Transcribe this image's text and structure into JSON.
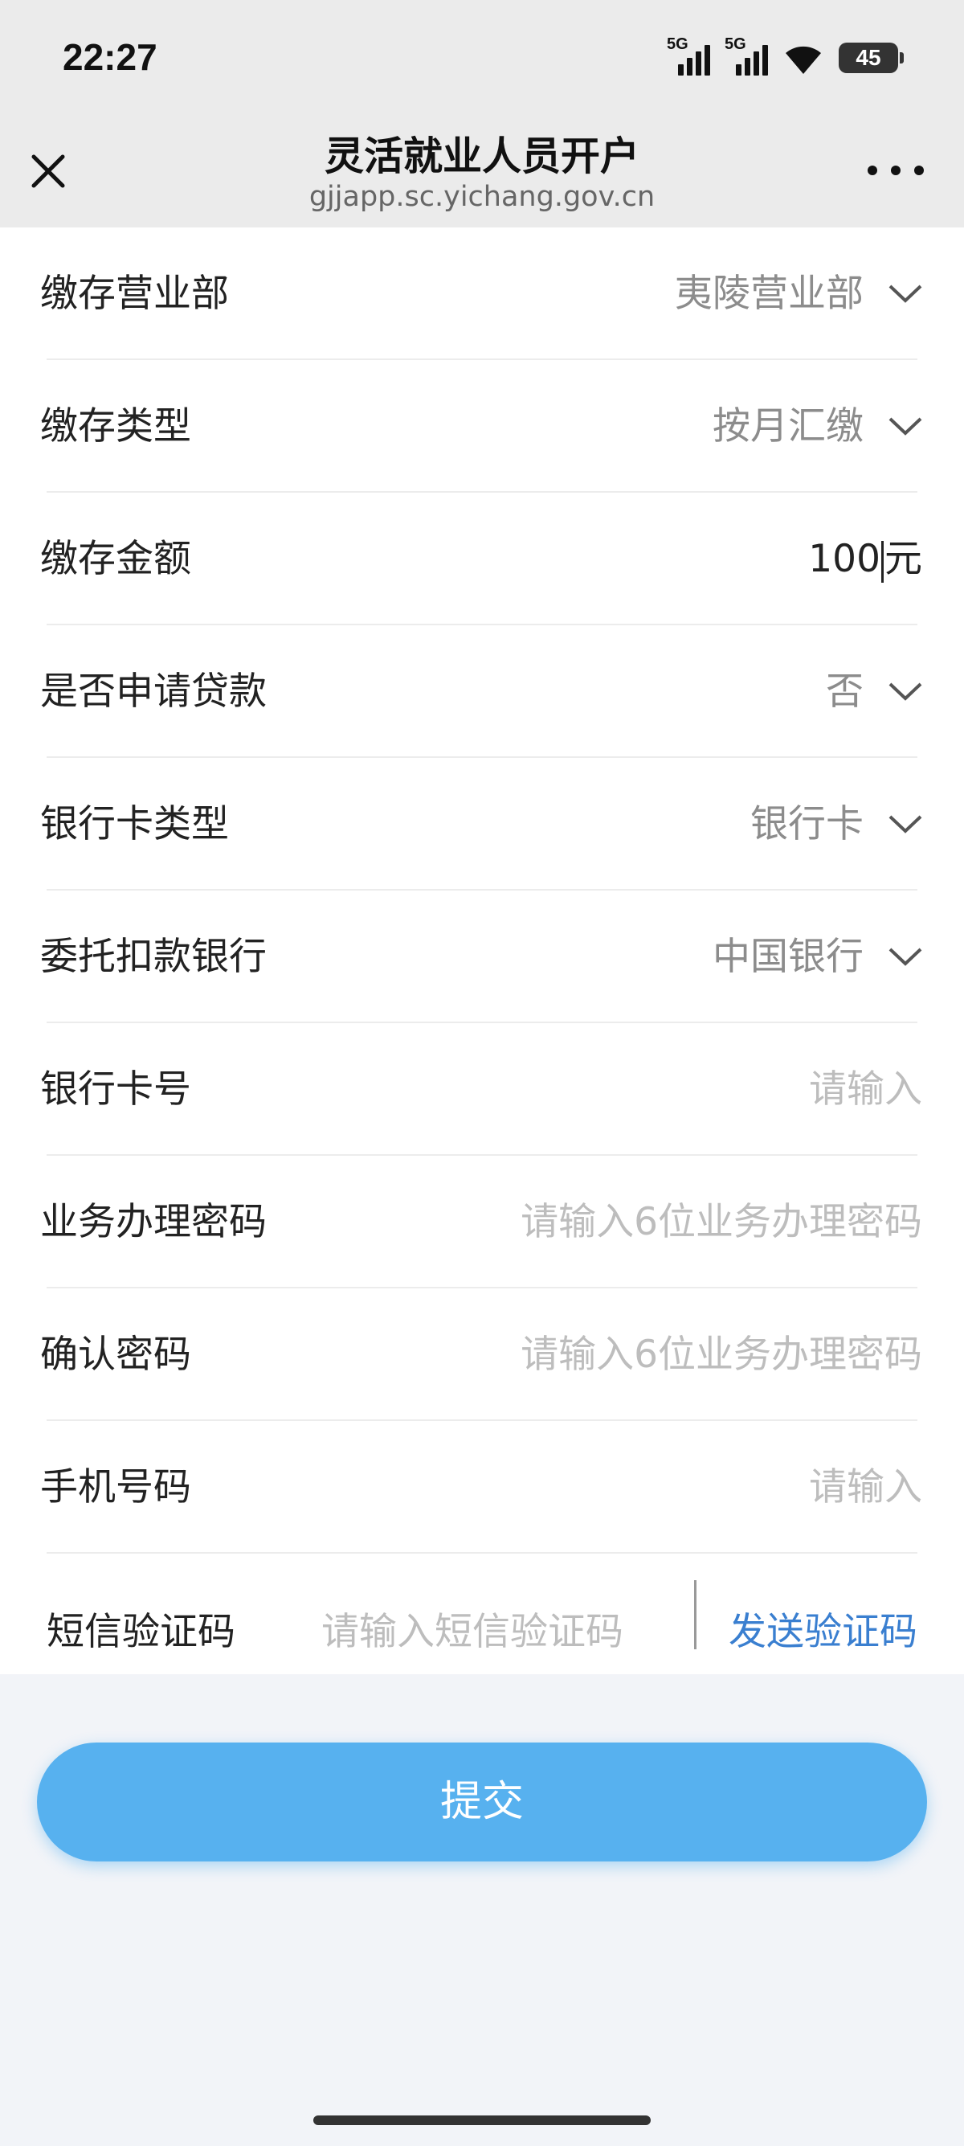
{
  "status_bar": {
    "time": "22:27",
    "network_1": "5G",
    "network_2": "5G",
    "battery": "45"
  },
  "nav": {
    "title": "灵活就业人员开户",
    "url": "gjjapp.sc.yichang.gov.cn"
  },
  "form": {
    "rows": [
      {
        "label": "缴存营业部",
        "value": "夷陵营业部"
      },
      {
        "label": "缴存类型",
        "value": "按月汇缴"
      },
      {
        "label": "缴存金额",
        "value": "100",
        "unit": "元"
      },
      {
        "label": "是否申请贷款",
        "value": "否"
      },
      {
        "label": "银行卡类型",
        "value": "银行卡"
      },
      {
        "label": "委托扣款银行",
        "value": "中国银行"
      },
      {
        "label": "银行卡号",
        "placeholder": "请输入"
      },
      {
        "label": "业务办理密码",
        "placeholder": "请输入6位业务办理密码"
      },
      {
        "label": "确认密码",
        "placeholder": "请输入6位业务办理密码"
      },
      {
        "label": "手机号码",
        "placeholder": "请输入"
      }
    ],
    "sms": {
      "label": "短信验证码",
      "placeholder": "请输入短信验证码",
      "send_label": "发送验证码"
    }
  },
  "submit_label": "提交",
  "colors": {
    "accent": "#57b1ef",
    "link": "#3a7fd0"
  }
}
